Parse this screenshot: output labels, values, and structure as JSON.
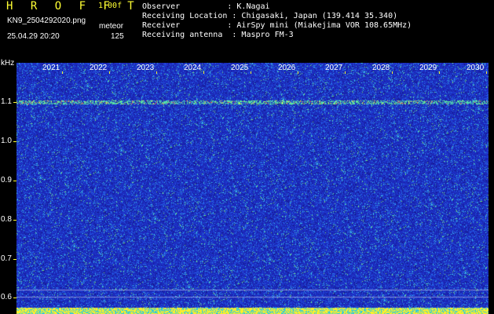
{
  "header": {
    "title": "H R O F F T",
    "version": "1.00f",
    "file_name": "KN9_2504292020.png",
    "mode": "meteor",
    "timestamp": "25.04.29 20:20",
    "count": "125",
    "meta": [
      {
        "label": "Observer          : K.Nagai"
      },
      {
        "label": "Receiving Location : Chigasaki, Japan (139.414 35.340)"
      },
      {
        "label": "Receiver          : AirSpy mini (Miakejima VOR 108.65MHz)"
      },
      {
        "label": "Receiving antenna  : Maspro FM-3"
      }
    ]
  },
  "axis": {
    "y_unit": "kHz",
    "y_ticks": [
      "1.1",
      "1.0",
      "0.9",
      "0.8",
      "0.7",
      "0.6"
    ],
    "x_ticks": [
      "2021",
      "2022",
      "2023",
      "2024",
      "2025",
      "2026",
      "2027",
      "2028",
      "2029",
      "2030"
    ]
  },
  "colors": {
    "label": "#ffff33",
    "value": "#ffffff",
    "background": "#1c2fb8"
  }
}
